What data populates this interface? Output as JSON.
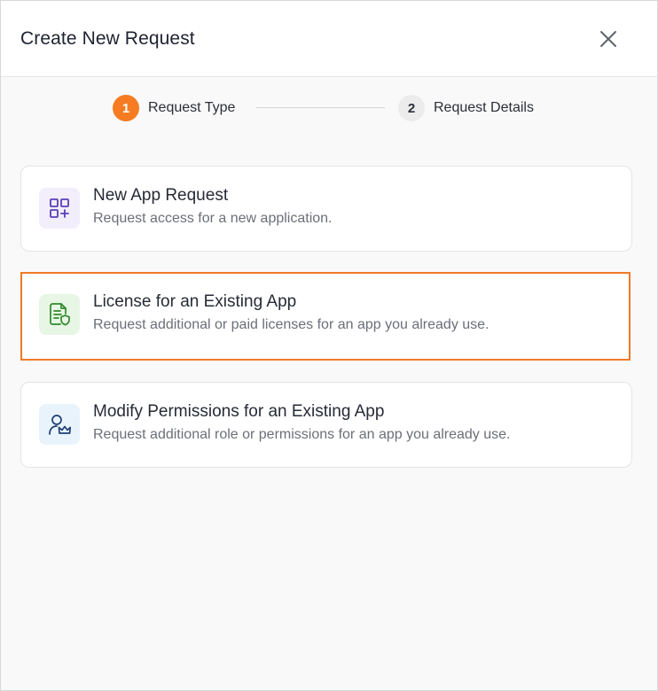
{
  "header": {
    "title": "Create New Request",
    "close_icon": "close-icon"
  },
  "stepper": {
    "steps": [
      {
        "number": "1",
        "label": "Request Type",
        "state": "active"
      },
      {
        "number": "2",
        "label": "Request Details",
        "state": "inactive"
      }
    ]
  },
  "options": [
    {
      "title": "New App Request",
      "description": "Request access for a new application.",
      "icon": "apps-add-icon",
      "icon_color": "#5b3fb8",
      "selected": false
    },
    {
      "title": "License for an Existing App",
      "description": "Request additional or paid licenses for an app you already use.",
      "icon": "license-document-icon",
      "icon_color": "#2f8a2a",
      "selected": true
    },
    {
      "title": "Modify Permissions for an Existing App",
      "description": "Request additional role or permissions for an app you already use.",
      "icon": "user-crown-icon",
      "icon_color": "#1e3f73",
      "selected": false
    }
  ],
  "colors": {
    "accent": "#f57c23",
    "selected_border": "#f07a26"
  }
}
